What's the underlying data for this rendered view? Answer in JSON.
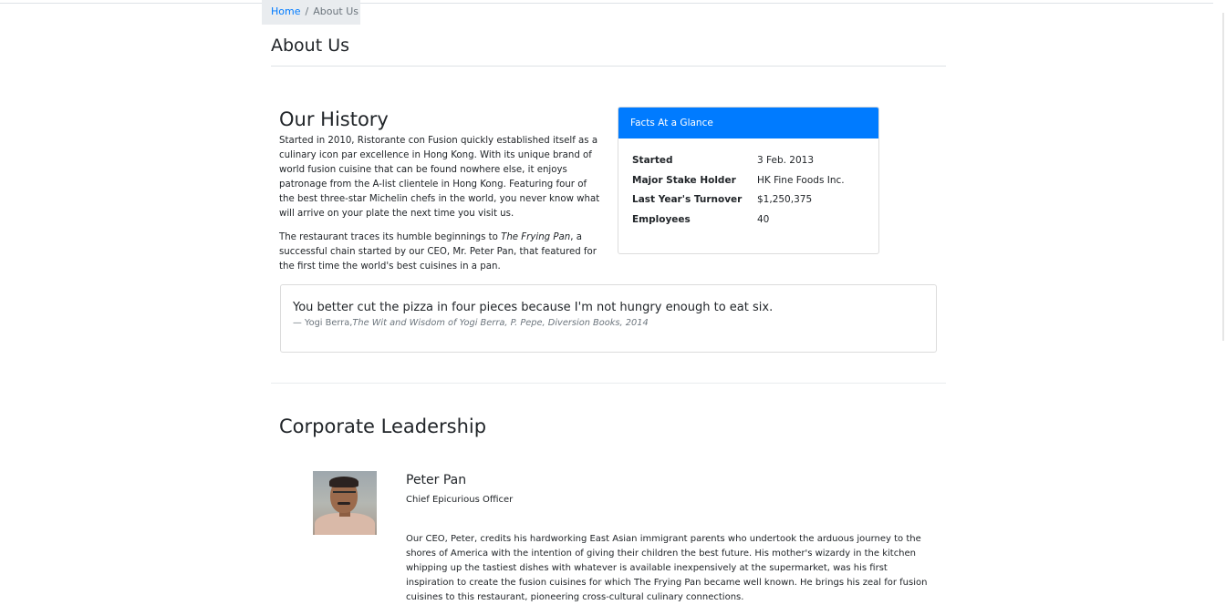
{
  "breadcrumb": {
    "home": "Home",
    "separator": "/",
    "current": "About Us"
  },
  "page_title": "About Us",
  "history": {
    "title": "Our History",
    "paragraph1": "Started in 2010, Ristorante con Fusion quickly established itself as a culinary icon par excellence in Hong Kong. With its unique brand of world fusion cuisine that can be found nowhere else, it enjoys patronage from the A-list clientele in Hong Kong. Featuring four of the best three-star Michelin chefs in the world, you never know what will arrive on your plate the next time you visit us.",
    "paragraph2_start": "The restaurant traces its humble beginnings to ",
    "paragraph2_em": "The Frying Pan",
    "paragraph2_end": ", a successful chain started by our CEO, Mr. Peter Pan, that featured for the first time the world's best cuisines in a pan."
  },
  "facts": {
    "header": "Facts At a Glance",
    "rows": [
      {
        "key": "Started",
        "value": "3 Feb. 2013"
      },
      {
        "key": "Major Stake Holder",
        "value": "HK Fine Foods Inc."
      },
      {
        "key": "Last Year's Turnover",
        "value": "$1,250,375"
      },
      {
        "key": "Employees",
        "value": "40"
      }
    ]
  },
  "quote": {
    "text": "You better cut the pizza in four pieces because I'm not hungry enough to eat six.",
    "author": "— Yogi Berra,",
    "source": "The Wit and Wisdom of Yogi Berra, P. Pepe, Diversion Books, 2014"
  },
  "leadership": {
    "title": "Corporate Leadership",
    "leaders": [
      {
        "name": "Peter Pan",
        "role": "Chief Epicurious Officer",
        "bio": "Our CEO, Peter, credits his hardworking East Asian immigrant parents who undertook the arduous journey to the shores of America with the intention of giving their children the best future. His mother's wizardy in the kitchen whipping up the tastiest dishes with whatever is available inexpensively at the supermarket, was his first inspiration to create the fusion cuisines for which The Frying Pan became well known. He brings his zeal for fusion cuisines to this restaurant, pioneering cross-cultural culinary connections."
      }
    ]
  },
  "colors": {
    "primary": "#007bff",
    "breadcrumb_bg": "#e9ecef",
    "border": "#dee2e6",
    "muted": "#6c757d"
  }
}
